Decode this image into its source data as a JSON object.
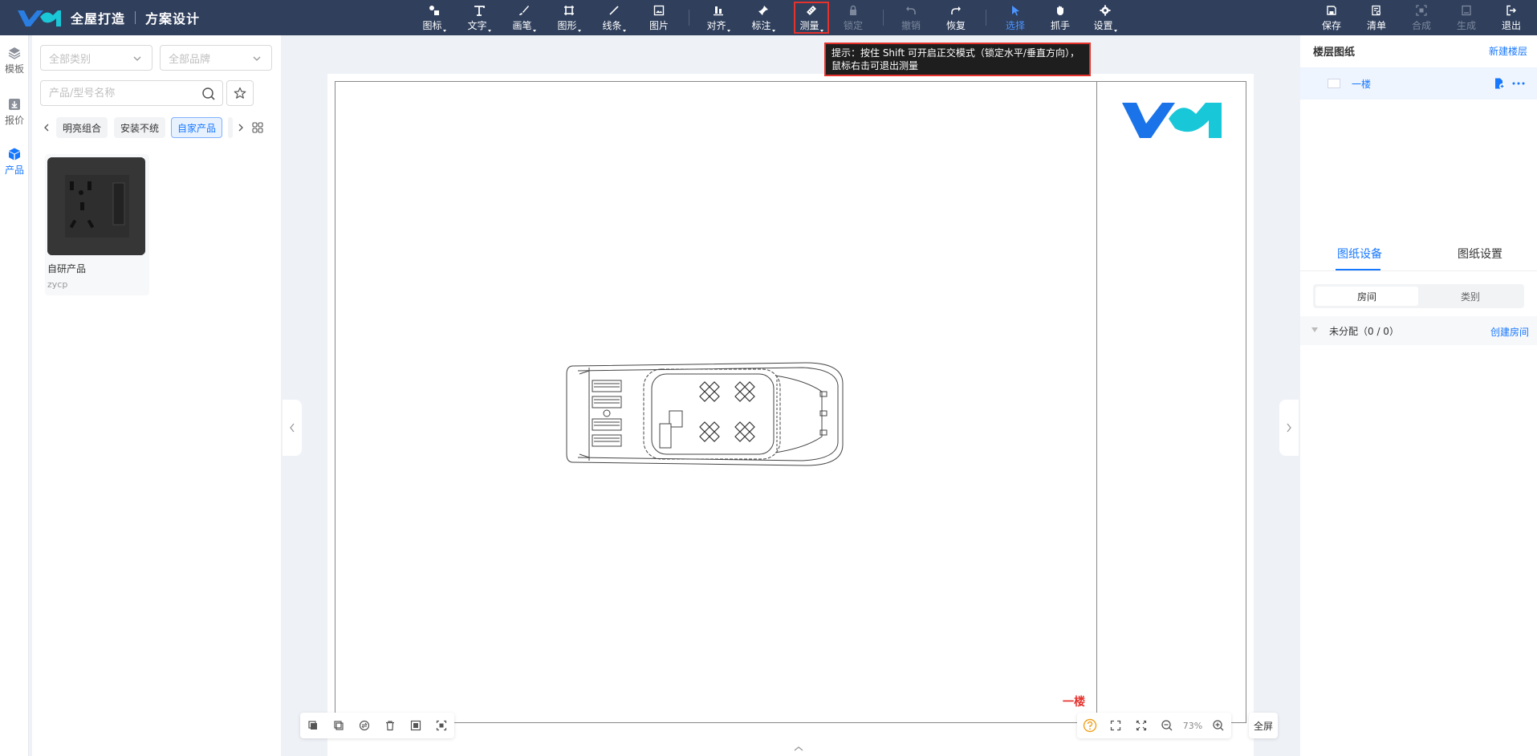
{
  "app": {
    "product_name": "全屋打造",
    "project_title": "方案设计"
  },
  "toolbar": {
    "icon": "图标",
    "text": "文字",
    "brush": "画笔",
    "shape": "图形",
    "line": "线条",
    "image": "图片",
    "align": "对齐",
    "annotate": "标注",
    "measure": "测量",
    "lock": "锁定",
    "undo": "撤销",
    "redo": "恢复",
    "select": "选择",
    "hand": "抓手",
    "settings": "设置",
    "save": "保存",
    "list": "清单",
    "compose": "合成",
    "generate": "生成",
    "exit": "退出"
  },
  "rail": {
    "template": "模板",
    "quote": "报价",
    "product": "产品"
  },
  "product_panel": {
    "category_placeholder": "全部类别",
    "brand_placeholder": "全部品牌",
    "search_placeholder": "产品/型号名称",
    "chips": [
      "明亮组合",
      "安装不统",
      "自家产品"
    ],
    "active_chip": "自家产品",
    "item": {
      "name": "自研产品",
      "code": "zycp"
    }
  },
  "canvas": {
    "measure_tip": "提示：按住 Shift 可开启正交模式（锁定水平/垂直方向），鼠标右击可退出测量",
    "floor_label": "一楼",
    "zoom": "73%",
    "fullscreen": "全屏"
  },
  "right_panel": {
    "title": "楼层图纸",
    "new_floor": "新建楼层",
    "floors": [
      "一楼"
    ],
    "tabs": [
      "图纸设备",
      "图纸设置"
    ],
    "segments": [
      "房间",
      "类别"
    ],
    "group_label": "未分配（0 / 0）",
    "create_room": "创建房间"
  },
  "colors": {
    "topbar": "#2f3f5c",
    "accent": "#1677ff",
    "highlight": "#e5322d",
    "logo_blue": "#1a73e8",
    "logo_cyan": "#18c8d8"
  }
}
